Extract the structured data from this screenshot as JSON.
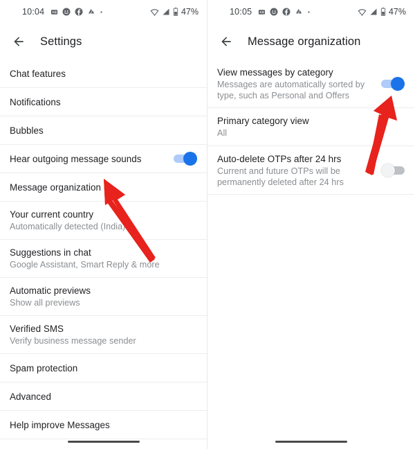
{
  "accent": {
    "toggle_on_thumb": "#1a73e8",
    "toggle_on_track": "#aecbfa",
    "toggle_off_thumb": "#f1f3f4",
    "toggle_off_track": "#bdc1c6",
    "arrow_color": "#e8221c",
    "title_color": "#202124",
    "subtitle_color": "#8a8d91"
  },
  "left_panel": {
    "status": {
      "time": "10:04",
      "battery_percent": "47%",
      "icons": [
        "app-badge-icon",
        "emoji-circle-icon",
        "facebook-icon",
        "app-glyph-icon",
        "dot-icon"
      ],
      "right_icons": [
        "wifi-icon",
        "signal-bars-icon",
        "battery-icon"
      ]
    },
    "appbar": {
      "back_icon": "back-arrow-icon",
      "title": "Settings"
    },
    "items": [
      {
        "title": "Chat features",
        "sub": "",
        "toggle": null
      },
      {
        "title": "Notifications",
        "sub": "",
        "toggle": null
      },
      {
        "title": "Bubbles",
        "sub": "",
        "toggle": null
      },
      {
        "title": "Hear outgoing message sounds",
        "sub": "",
        "toggle": "on"
      },
      {
        "title": "Message organization",
        "sub": "",
        "toggle": null
      },
      {
        "title": "Your current country",
        "sub": "Automatically detected (India)",
        "toggle": null
      },
      {
        "title": "Suggestions in chat",
        "sub": "Google Assistant, Smart Reply & more",
        "toggle": null
      },
      {
        "title": "Automatic previews",
        "sub": "Show all previews",
        "toggle": null
      },
      {
        "title": "Verified SMS",
        "sub": "Verify business message sender",
        "toggle": null
      },
      {
        "title": "Spam protection",
        "sub": "",
        "toggle": null
      },
      {
        "title": "Advanced",
        "sub": "",
        "toggle": null
      },
      {
        "title": "Help improve Messages",
        "sub": "",
        "toggle": null
      }
    ]
  },
  "right_panel": {
    "status": {
      "time": "10:05",
      "battery_percent": "47%",
      "icons": [
        "app-badge-icon",
        "emoji-circle-icon",
        "facebook-icon",
        "app-glyph-icon",
        "dot-icon"
      ],
      "right_icons": [
        "wifi-icon",
        "signal-bars-icon",
        "battery-icon"
      ]
    },
    "appbar": {
      "back_icon": "back-arrow-icon",
      "title": "Message organization"
    },
    "items": [
      {
        "title": "View messages by category",
        "sub": "Messages are automatically sorted by type, such as Personal and Offers",
        "toggle": "on"
      },
      {
        "title": "Primary category view",
        "sub": "All",
        "toggle": null
      },
      {
        "title": "Auto-delete OTPs after 24 hrs",
        "sub": "Current and future OTPs will be permanently deleted after 24 hrs",
        "toggle": "off"
      }
    ]
  },
  "annotations": {
    "left_arrow": "red-arrow-pointing-to-message-organization",
    "right_arrow": "red-arrow-pointing-to-view-messages-by-category-toggle"
  }
}
